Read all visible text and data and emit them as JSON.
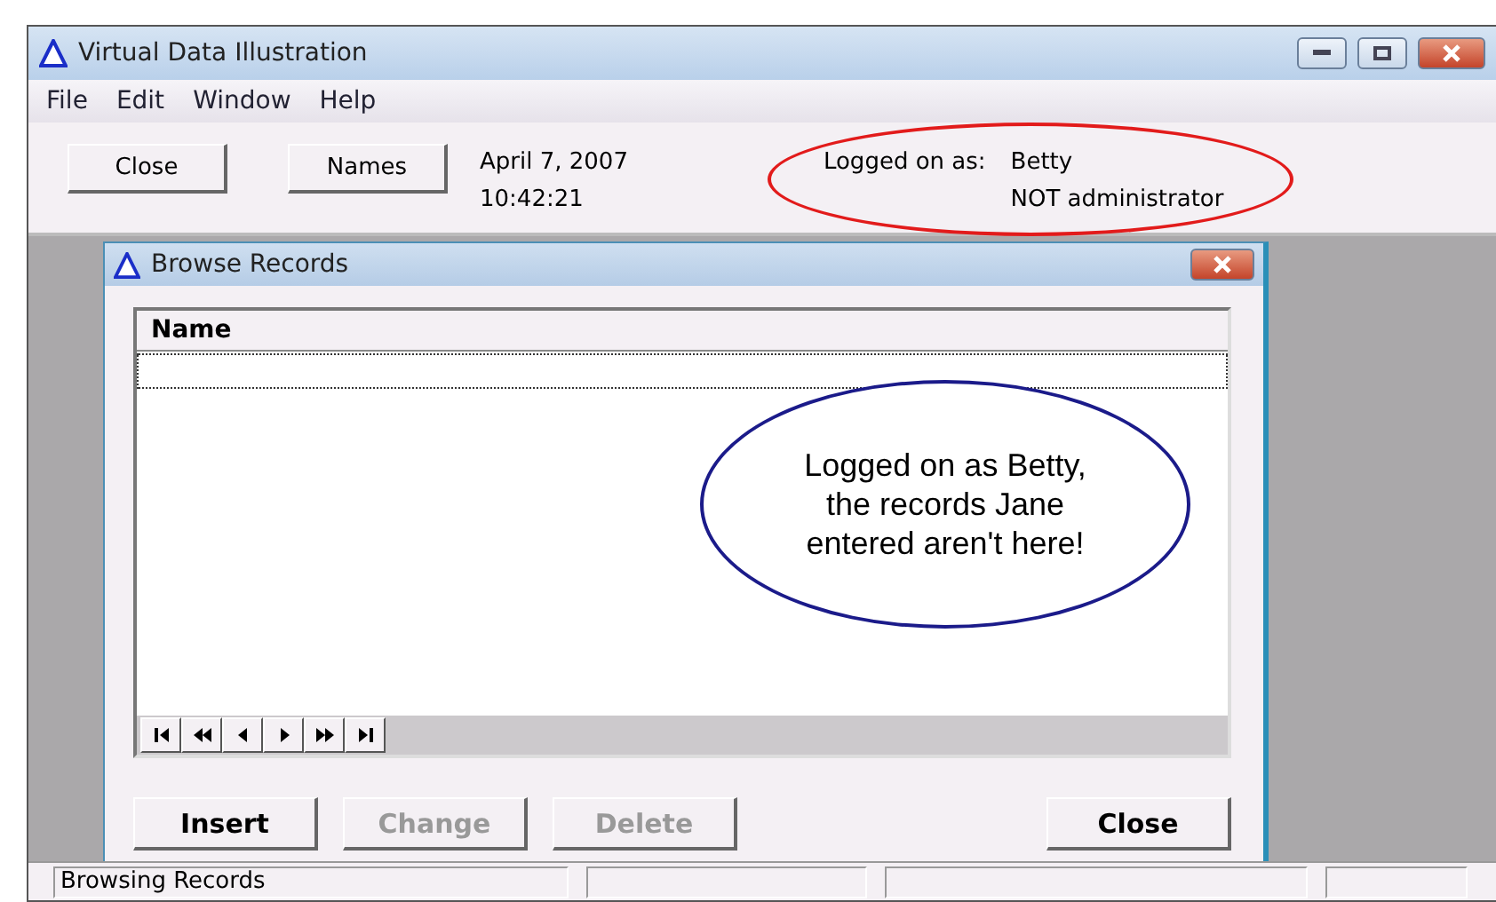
{
  "window": {
    "title": "Virtual Data Illustration"
  },
  "menu": [
    "File",
    "Edit",
    "Window",
    "Help"
  ],
  "toolbar": {
    "buttons": [
      "Close",
      "Names"
    ],
    "date": "April  7, 2007",
    "time": "10:42:21",
    "logged_label": "Logged on as:",
    "user": "Betty",
    "role": "NOT administrator"
  },
  "child_window": {
    "title": "Browse Records",
    "column": "Name",
    "nav_buttons": [
      {
        "kind": "first"
      },
      {
        "kind": "prev_page"
      },
      {
        "kind": "prev"
      },
      {
        "kind": "next"
      },
      {
        "kind": "next_page"
      },
      {
        "kind": "last"
      }
    ],
    "buttons": [
      {
        "label": "Insert",
        "disabled": false
      },
      {
        "label": "Change",
        "disabled": true
      },
      {
        "label": "Delete",
        "disabled": true
      },
      {
        "label": "Close",
        "disabled": false
      }
    ]
  },
  "callout": "Logged on as Betty, the records Jane entered aren't here!",
  "status_bar": {
    "text": "Browsing Records"
  }
}
